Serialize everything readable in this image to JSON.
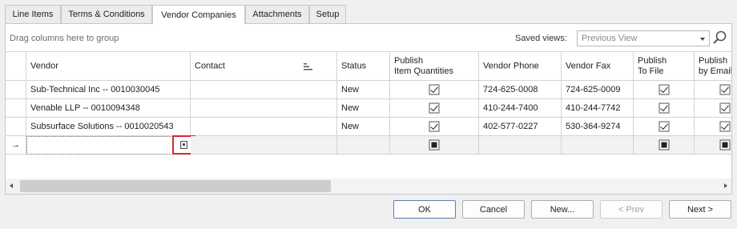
{
  "tabs": [
    {
      "label": "Line Items",
      "active": false
    },
    {
      "label": "Terms & Conditions",
      "active": false
    },
    {
      "label": "Vendor Companies",
      "active": true
    },
    {
      "label": "Attachments",
      "active": false
    },
    {
      "label": "Setup",
      "active": false
    }
  ],
  "toolbar": {
    "group_hint": "Drag columns here to group",
    "saved_views_label": "Saved views:",
    "saved_views_value": "Previous View",
    "search_icon": "magnifier-icon"
  },
  "columns": [
    "Vendor",
    "Contact",
    "Status",
    "Publish\nItem Quantities",
    "Vendor Phone",
    "Vendor Fax",
    "Publish\nTo File",
    "Publish\nby Email"
  ],
  "rows": [
    {
      "vendor": "Sub-Technical Inc -- 0010030045",
      "contact": "",
      "status": "New",
      "publish_qty": true,
      "phone": "724-625-0008",
      "fax": "724-625-0009",
      "to_file": true,
      "by_email": true
    },
    {
      "vendor": "Venable LLP -- 0010094348",
      "contact": "",
      "status": "New",
      "publish_qty": true,
      "phone": "410-244-7400",
      "fax": "410-244-7742",
      "to_file": true,
      "by_email": true
    },
    {
      "vendor": "Subsurface Solutions -- 0010020543",
      "contact": "",
      "status": "New",
      "publish_qty": true,
      "phone": "402-577-0227",
      "fax": "530-364-9274",
      "to_file": true,
      "by_email": true
    }
  ],
  "new_row": {
    "indicator": "→",
    "picker_icon": "lookup-icon"
  },
  "buttons": {
    "ok": "OK",
    "cancel": "Cancel",
    "new": "New...",
    "prev": "< Prev",
    "next": "Next >"
  }
}
